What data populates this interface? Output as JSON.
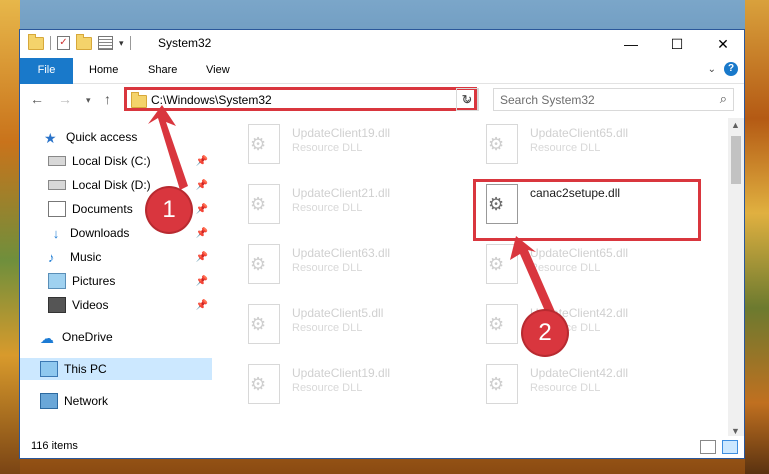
{
  "window": {
    "title": "System32"
  },
  "ribbon": {
    "tabs": [
      "File",
      "Home",
      "Share",
      "View"
    ],
    "help": "?"
  },
  "nav": {
    "address": "C:\\Windows\\System32",
    "search_placeholder": "Search System32"
  },
  "sidebar": {
    "items": [
      {
        "label": "Quick access",
        "icon": "star-icon"
      },
      {
        "label": "Local Disk (C:)",
        "icon": "disk-icon",
        "pinned": true
      },
      {
        "label": "Local Disk (D:)",
        "icon": "disk-icon",
        "pinned": true
      },
      {
        "label": "Documents",
        "icon": "document-icon",
        "pinned": true
      },
      {
        "label": "Downloads",
        "icon": "download-icon",
        "pinned": true
      },
      {
        "label": "Music",
        "icon": "music-icon",
        "pinned": true
      },
      {
        "label": "Pictures",
        "icon": "picture-icon",
        "pinned": true
      },
      {
        "label": "Videos",
        "icon": "video-icon",
        "pinned": true
      },
      {
        "label": "OneDrive",
        "icon": "cloud-icon"
      },
      {
        "label": "This PC",
        "icon": "computer-icon",
        "selected": true
      },
      {
        "label": "Network",
        "icon": "network-icon"
      }
    ]
  },
  "files": [
    {
      "name": "UpdateClient19.dll",
      "type": "Resource DLL"
    },
    {
      "name": "UpdateClient65.dll",
      "type": "Resource DLL"
    },
    {
      "name": "UpdateClient21.dll",
      "type": "Resource DLL"
    },
    {
      "name": "canac2setupe.dll",
      "type": ""
    },
    {
      "name": "UpdateClient63.dll",
      "type": "Resource DLL"
    },
    {
      "name": "UpdateClient65.dll",
      "type": "Resource DLL"
    },
    {
      "name": "UpdateClient5.dll",
      "type": "Resource DLL"
    },
    {
      "name": "UpdateClient42.dll",
      "type": "Resource DLL"
    },
    {
      "name": "UpdateClient19.dll",
      "type": "Resource DLL"
    },
    {
      "name": "UpdateClient42.dll",
      "type": "Resource DLL"
    }
  ],
  "status": {
    "item_count": "116 items"
  },
  "annotations": {
    "step1": "1",
    "step2": "2",
    "color": "#d9363e"
  }
}
